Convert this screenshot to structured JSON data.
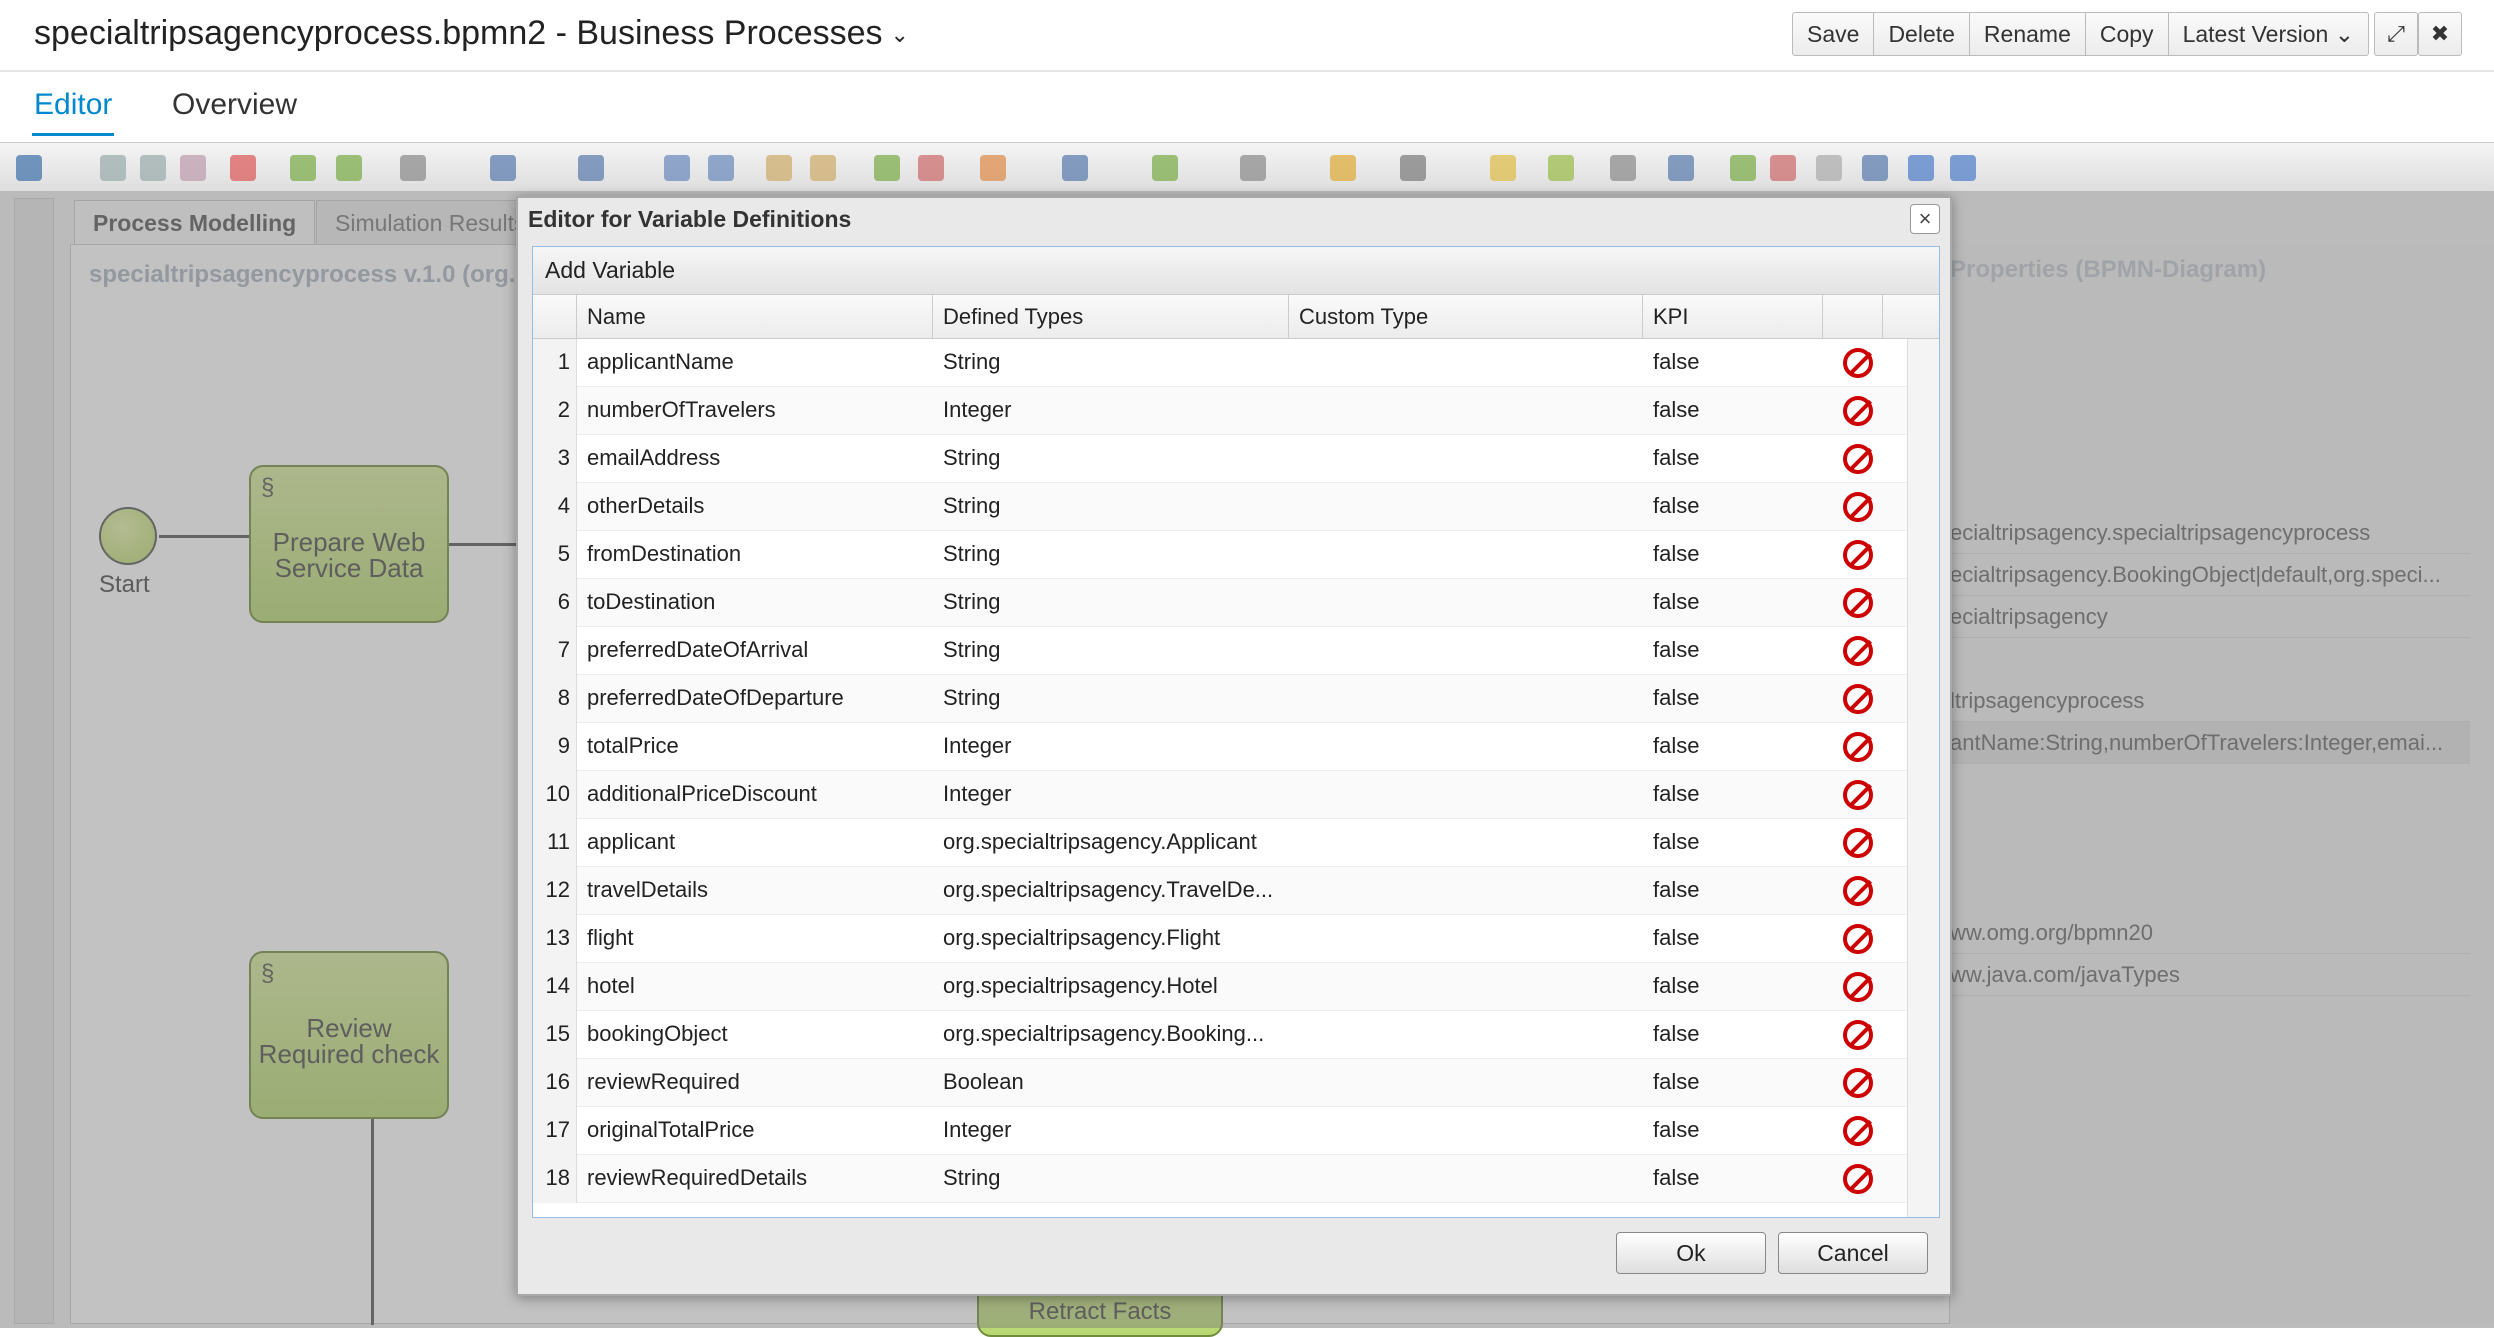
{
  "header": {
    "title": "specialtripsagencyprocess.bpmn2 - Business Processes",
    "buttons": {
      "save": "Save",
      "delete": "Delete",
      "rename": "Rename",
      "copy": "Copy",
      "version": "Latest Version"
    }
  },
  "tabs": {
    "editor": "Editor",
    "overview": "Overview"
  },
  "workspace": {
    "tab_modelling": "Process Modelling",
    "tab_simulation": "Simulation Results",
    "process_label": "specialtripsagencyprocess v.1.0 (org...",
    "start_label": "Start",
    "task1": "Prepare Web Service Data",
    "task2": "Review Required check",
    "task3": "Retract Facts",
    "properties_title": "Properties (BPMN-Diagram)",
    "props": [
      "ecialtripsagency.specialtripsagencyprocess",
      "ecialtripsagency.BookingObject|default,org.speci...",
      "ecialtripsagency",
      "ltripsagencyprocess",
      "antName:String,numberOfTravelers:Integer,emai...",
      "ww.omg.org/bpmn20",
      "ww.java.com/javaTypes"
    ]
  },
  "modal": {
    "title": "Editor for Variable Definitions",
    "add_variable": "Add Variable",
    "columns": [
      "Name",
      "Defined Types",
      "Custom Type",
      "KPI"
    ],
    "rows": [
      {
        "n": "1",
        "name": "applicantName",
        "type": "String",
        "custom": "",
        "kpi": "false"
      },
      {
        "n": "2",
        "name": "numberOfTravelers",
        "type": "Integer",
        "custom": "",
        "kpi": "false"
      },
      {
        "n": "3",
        "name": "emailAddress",
        "type": "String",
        "custom": "",
        "kpi": "false"
      },
      {
        "n": "4",
        "name": "otherDetails",
        "type": "String",
        "custom": "",
        "kpi": "false"
      },
      {
        "n": "5",
        "name": "fromDestination",
        "type": "String",
        "custom": "",
        "kpi": "false"
      },
      {
        "n": "6",
        "name": "toDestination",
        "type": "String",
        "custom": "",
        "kpi": "false"
      },
      {
        "n": "7",
        "name": "preferredDateOfArrival",
        "type": "String",
        "custom": "",
        "kpi": "false"
      },
      {
        "n": "8",
        "name": "preferredDateOfDeparture",
        "type": "String",
        "custom": "",
        "kpi": "false"
      },
      {
        "n": "9",
        "name": "totalPrice",
        "type": "Integer",
        "custom": "",
        "kpi": "false"
      },
      {
        "n": "10",
        "name": "additionalPriceDiscount",
        "type": "Integer",
        "custom": "",
        "kpi": "false"
      },
      {
        "n": "11",
        "name": "applicant",
        "type": "org.specialtripsagency.Applicant",
        "custom": "",
        "kpi": "false"
      },
      {
        "n": "12",
        "name": "travelDetails",
        "type": "org.specialtripsagency.TravelDe...",
        "custom": "",
        "kpi": "false"
      },
      {
        "n": "13",
        "name": "flight",
        "type": "org.specialtripsagency.Flight",
        "custom": "",
        "kpi": "false"
      },
      {
        "n": "14",
        "name": "hotel",
        "type": "org.specialtripsagency.Hotel",
        "custom": "",
        "kpi": "false"
      },
      {
        "n": "15",
        "name": "bookingObject",
        "type": "org.specialtripsagency.Booking...",
        "custom": "",
        "kpi": "false"
      },
      {
        "n": "16",
        "name": "reviewRequired",
        "type": "Boolean",
        "custom": "",
        "kpi": "false"
      },
      {
        "n": "17",
        "name": "originalTotalPrice",
        "type": "Integer",
        "custom": "",
        "kpi": "false"
      },
      {
        "n": "18",
        "name": "reviewRequiredDetails",
        "type": "String",
        "custom": "",
        "kpi": "false"
      }
    ],
    "ok": "Ok",
    "cancel": "Cancel"
  }
}
